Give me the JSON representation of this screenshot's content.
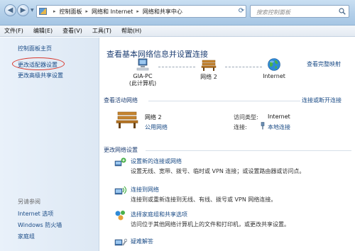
{
  "addressbar": {
    "crumbs": [
      "控制面板",
      "网络和 Internet",
      "网络和共享中心"
    ]
  },
  "search": {
    "placeholder": "搜索控制面板"
  },
  "menu": {
    "items": [
      "文件(F)",
      "编辑(E)",
      "查看(V)",
      "工具(T)",
      "帮助(H)"
    ]
  },
  "sidebar": {
    "home": "控制面板主页",
    "change_adapter": "更改适配器设置",
    "change_sharing": "更改高级共享设置",
    "see_also_heading": "另请参阅",
    "see_also": [
      "Internet 选项",
      "Windows 防火墙",
      "家庭组"
    ]
  },
  "main": {
    "title": "查看基本网络信息并设置连接",
    "full_map_link": "查看完整映射",
    "map": {
      "computer_name": "GIA-PC",
      "computer_sub": "(此计算机)",
      "network_name": "网络 2",
      "internet": "Internet"
    },
    "active": {
      "heading": "查看活动网络",
      "connect_link": "连接或断开连接",
      "network_name": "网络 2",
      "network_type": "公用网络",
      "access_label": "访问类型:",
      "access_value": "Internet",
      "connection_label": "连接:",
      "connection_value": "本地连接"
    },
    "change": {
      "heading": "更改网络设置",
      "tasks": [
        {
          "title": "设置新的连接或网络",
          "desc": "设置无线、宽带、拨号、临时或 VPN 连接；或设置路由器或访问点。"
        },
        {
          "title": "连接到网络",
          "desc": "连接到或重新连接到无线、有线、拨号或 VPN 网络连接。"
        },
        {
          "title": "选择家庭组和共享选项",
          "desc": "访问位于其他网络计算机上的文件和打印机，或更改共享设置。"
        },
        {
          "title": "疑难解答",
          "desc": ""
        }
      ]
    }
  },
  "colors": {
    "link": "#1a4b86",
    "title": "#1e3f73",
    "highlight_ellipse": "#d93a2f"
  }
}
